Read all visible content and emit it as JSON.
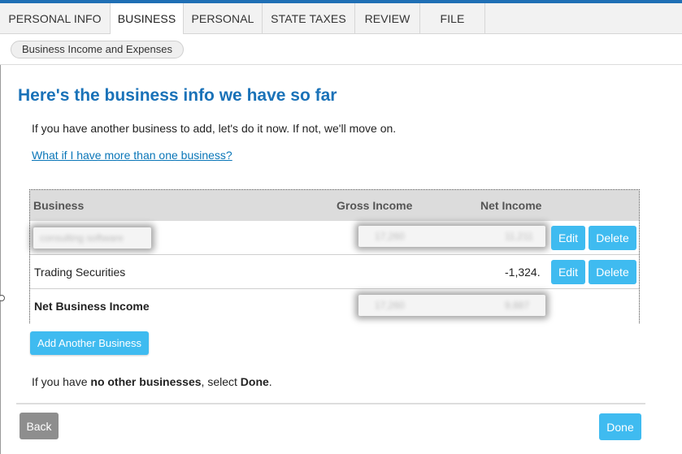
{
  "tabs": [
    {
      "label": "PERSONAL INFO",
      "active": false
    },
    {
      "label": "BUSINESS",
      "active": true
    },
    {
      "label": "PERSONAL",
      "active": false
    },
    {
      "label": "STATE TAXES",
      "active": false
    },
    {
      "label": "REVIEW",
      "active": false
    },
    {
      "label": "FILE",
      "active": false
    }
  ],
  "breadcrumb": {
    "label": "Business Income and Expenses"
  },
  "page": {
    "title": "Here's the business info we have so far",
    "intro": "If you have another business to add, let's do it now. If not, we'll move on.",
    "help_link": "What if I have more than one business?"
  },
  "table": {
    "headers": {
      "business": "Business",
      "gross": "Gross Income",
      "net": "Net Income"
    },
    "rows": [
      {
        "business": "consulting software",
        "gross": "17,260",
        "net": "11,211",
        "redacted": true
      },
      {
        "business": "Trading Securities",
        "gross": "",
        "net": "-1,324.",
        "redacted": false
      },
      {
        "business": "Net Business Income",
        "gross": "17,260",
        "net": "9,887",
        "redacted": true
      }
    ],
    "edit_label": "Edit",
    "delete_label": "Delete"
  },
  "actions": {
    "add_business": "Add Another Business",
    "note_prefix": "If you have ",
    "note_bold1": "no other businesses",
    "note_mid": ", select ",
    "note_bold2": "Done",
    "note_suffix": ".",
    "back": "Back",
    "done": "Done"
  },
  "colors": {
    "accent": "#1a72b8",
    "button": "#3fbbf0",
    "back_button": "#8e8e8e"
  }
}
